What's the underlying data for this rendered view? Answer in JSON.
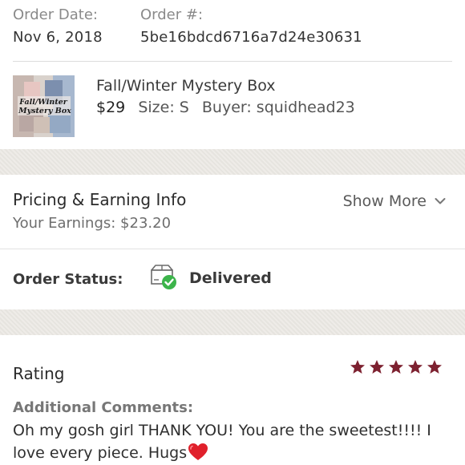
{
  "order": {
    "date_label": "Order Date:",
    "date_value": "Nov 6, 2018",
    "number_label": "Order #:",
    "number_value": "5be16bdcd6716a7d24e30631"
  },
  "item": {
    "title": "Fall/Winter Mystery Box",
    "price": "$29",
    "size": "Size: S",
    "buyer": "Buyer: squidhead23",
    "thumbnail_text_line1": "Fall/Winter",
    "thumbnail_text_line2": "Mystery Box"
  },
  "pricing": {
    "title": "Pricing & Earning Info",
    "earnings": "Your Earnings: $23.20",
    "show_more_label": "Show More",
    "show_more_icon": "chevron-down-icon"
  },
  "status": {
    "label": "Order Status:",
    "value": "Delivered",
    "icon": "box-delivered-icon",
    "check_color": "#3cb44b"
  },
  "rating": {
    "title": "Rating",
    "stars": 5,
    "max_stars": 5,
    "star_color": "#7d2130",
    "comments_label": "Additional Comments:",
    "comments_text": "Oh my gosh girl THANK YOU! You are the sweetest!!!! I love every piece. Hugs",
    "comments_emoji": "heart-icon",
    "heart_color": "#e0202b"
  }
}
